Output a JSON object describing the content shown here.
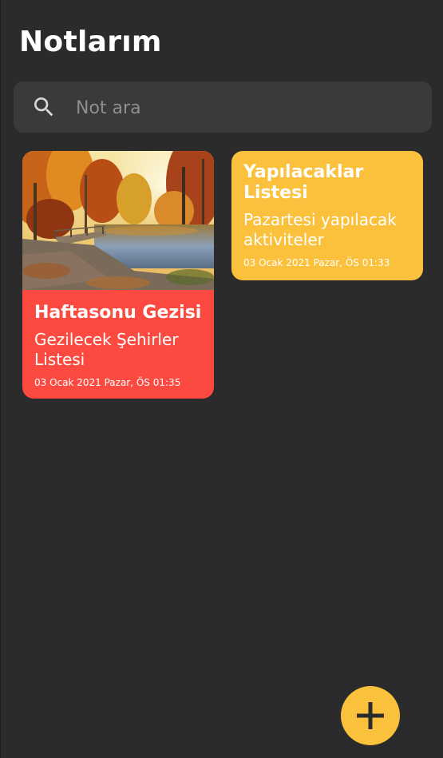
{
  "header": {
    "title": "Notlarım"
  },
  "search": {
    "placeholder": "Not ara",
    "value": "",
    "icon": "search-icon"
  },
  "notes": [
    {
      "title": "Haftasonu Gezisi",
      "subtitle": "Gezilecek Şehirler Listesi",
      "date": "03 Ocak 2021 Pazar, ÖS 01:35",
      "color": "#fc4a41",
      "has_image": true
    },
    {
      "title": "Yapılacaklar Listesi",
      "subtitle": "Pazartesi yapılacak aktiviteler",
      "date": "03 Ocak 2021 Pazar, ÖS 01:33",
      "color": "#fcc13c",
      "has_image": false
    }
  ],
  "fab": {
    "icon": "add-icon",
    "color": "#fcc13c"
  },
  "colors": {
    "background": "#2b2b2b",
    "search_background": "#3a3a3a",
    "accent": "#fcc13c"
  }
}
